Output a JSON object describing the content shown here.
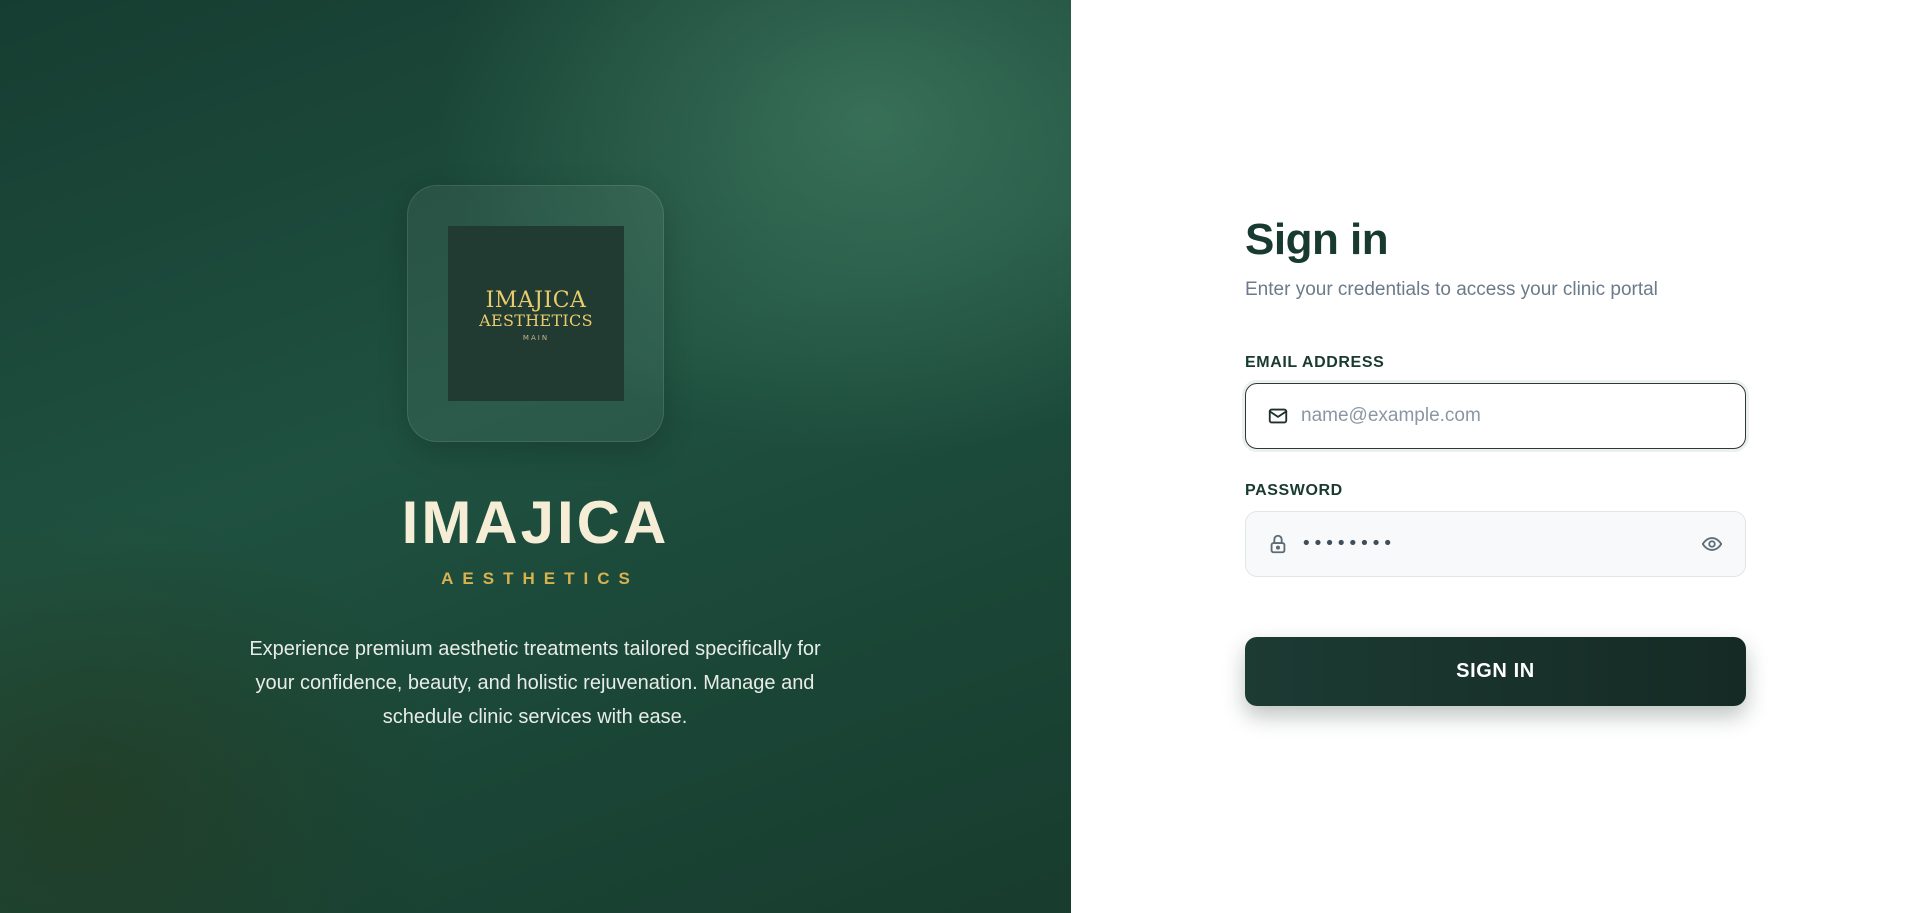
{
  "brand": {
    "logo": {
      "line1": "IMAJICA",
      "line2": "AESTHETICS",
      "line3": "MAIN"
    },
    "name": "IMAJICA",
    "tagline": "AESTHETICS",
    "description": "Experience premium aesthetic treatments tailored specifically for your confidence, beauty, and holistic rejuvenation. Manage and schedule clinic services with ease."
  },
  "form": {
    "title": "Sign in",
    "subtitle": "Enter your credentials to access your clinic portal",
    "email": {
      "label": "EMAIL ADDRESS",
      "placeholder": "name@example.com",
      "value": "",
      "icon": "mail-icon"
    },
    "password": {
      "label": "PASSWORD",
      "masked_value": "••••••••",
      "icon": "lock-icon",
      "toggle_icon": "eye-icon"
    },
    "submit_label": "SIGN IN"
  },
  "colors": {
    "brand_green": "#1f5140",
    "gold": "#d8b24e",
    "cream": "#f5edd6",
    "dark_button": "#1c3b33",
    "title_text": "#193a30"
  }
}
